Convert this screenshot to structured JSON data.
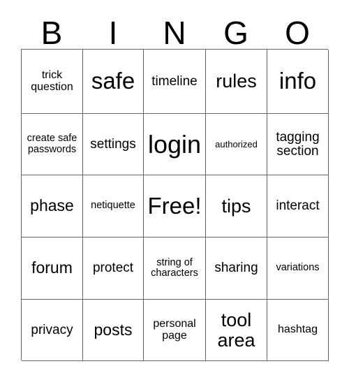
{
  "card": {
    "title": "BINGO",
    "header_letters": [
      "B",
      "I",
      "N",
      "G",
      "O"
    ],
    "columns": 5,
    "rows": 5,
    "free_space_label": "Free!",
    "border_color": "#666666",
    "background_color": "#ffffff",
    "text_color": "#000000",
    "cells": [
      [
        {
          "label": "trick question",
          "size": "s"
        },
        {
          "label": "safe",
          "size": "xxl"
        },
        {
          "label": "timeline",
          "size": "m"
        },
        {
          "label": "rules",
          "size": "xl"
        },
        {
          "label": "info",
          "size": "xxl"
        }
      ],
      [
        {
          "label": "create safe passwords",
          "size": "xs"
        },
        {
          "label": "settings",
          "size": "m"
        },
        {
          "label": "login",
          "size": "huge"
        },
        {
          "label": "authorized",
          "size": "xxs"
        },
        {
          "label": "tagging section",
          "size": "m"
        }
      ],
      [
        {
          "label": "phase",
          "size": "l"
        },
        {
          "label": "netiquette",
          "size": "xs"
        },
        {
          "label": "Free!",
          "size": "xxl"
        },
        {
          "label": "tips",
          "size": "xl"
        },
        {
          "label": "interact",
          "size": "m"
        }
      ],
      [
        {
          "label": "forum",
          "size": "l"
        },
        {
          "label": "protect",
          "size": "m"
        },
        {
          "label": "string of characters",
          "size": "xs"
        },
        {
          "label": "sharing",
          "size": "m"
        },
        {
          "label": "variations",
          "size": "xs"
        }
      ],
      [
        {
          "label": "privacy",
          "size": "m"
        },
        {
          "label": "posts",
          "size": "l"
        },
        {
          "label": "personal page",
          "size": "s"
        },
        {
          "label": "tool area",
          "size": "xl"
        },
        {
          "label": "hashtag",
          "size": "s"
        }
      ]
    ]
  }
}
